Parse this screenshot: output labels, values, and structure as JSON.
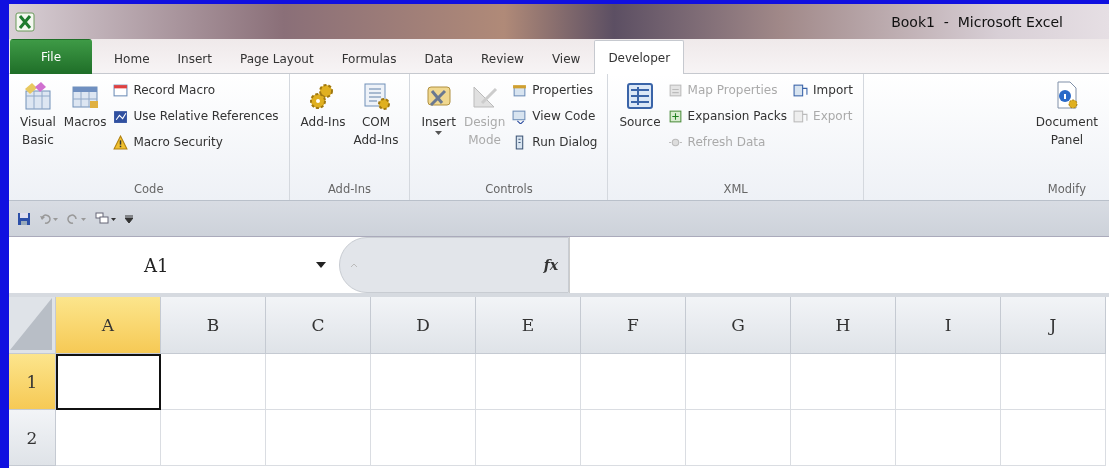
{
  "window": {
    "title": "Book1  -  Microsoft Excel"
  },
  "tabs": [
    {
      "label": "File",
      "kind": "file",
      "selected": false
    },
    {
      "label": "Home",
      "kind": "tab",
      "selected": false
    },
    {
      "label": "Insert",
      "kind": "tab",
      "selected": false
    },
    {
      "label": "Page Layout",
      "kind": "tab",
      "selected": false
    },
    {
      "label": "Formulas",
      "kind": "tab",
      "selected": false
    },
    {
      "label": "Data",
      "kind": "tab",
      "selected": false
    },
    {
      "label": "Review",
      "kind": "tab",
      "selected": false
    },
    {
      "label": "View",
      "kind": "tab",
      "selected": false
    },
    {
      "label": "Developer",
      "kind": "tab",
      "selected": true
    }
  ],
  "ribbon": {
    "groups": [
      {
        "label": "Code",
        "items": [
          {
            "kind": "large",
            "label": "Visual\nBasic",
            "disabled": false
          },
          {
            "kind": "large",
            "label": "Macros",
            "disabled": false
          },
          {
            "kind": "stack",
            "items": [
              {
                "label": "Record Macro",
                "disabled": false
              },
              {
                "label": "Use Relative References",
                "disabled": false
              },
              {
                "label": "Macro Security",
                "disabled": false
              }
            ]
          }
        ]
      },
      {
        "label": "Add-Ins",
        "items": [
          {
            "kind": "large",
            "label": "Add-Ins",
            "disabled": false
          },
          {
            "kind": "large",
            "label": "COM\nAdd-Ins",
            "disabled": false
          }
        ]
      },
      {
        "label": "Controls",
        "items": [
          {
            "kind": "large",
            "label": "Insert",
            "disabled": false,
            "dropdown": true
          },
          {
            "kind": "large",
            "label": "Design\nMode",
            "disabled": true
          },
          {
            "kind": "stack",
            "items": [
              {
                "label": "Properties",
                "disabled": false
              },
              {
                "label": "View Code",
                "disabled": false
              },
              {
                "label": "Run Dialog",
                "disabled": false
              }
            ]
          }
        ]
      },
      {
        "label": "XML",
        "items": [
          {
            "kind": "large",
            "label": "Source",
            "disabled": false
          },
          {
            "kind": "stack",
            "items": [
              {
                "label": "Map Properties",
                "disabled": true
              },
              {
                "label": "Expansion Packs",
                "disabled": false
              },
              {
                "label": "Refresh Data",
                "disabled": true
              }
            ]
          },
          {
            "kind": "stack",
            "items": [
              {
                "label": "Import",
                "disabled": false
              },
              {
                "label": "Export",
                "disabled": true
              }
            ]
          }
        ]
      },
      {
        "label": "Modify",
        "items": [
          {
            "kind": "large",
            "label": "Document\nPanel",
            "disabled": false
          }
        ]
      }
    ]
  },
  "formula_bar": {
    "name_box": "A1",
    "fx": "fx"
  },
  "sheet": {
    "columns": [
      {
        "label": "A",
        "selected": true
      },
      {
        "label": "B",
        "selected": false
      },
      {
        "label": "C",
        "selected": false
      },
      {
        "label": "D",
        "selected": false
      },
      {
        "label": "E",
        "selected": false
      },
      {
        "label": "F",
        "selected": false
      },
      {
        "label": "G",
        "selected": false
      },
      {
        "label": "H",
        "selected": false
      },
      {
        "label": "I",
        "selected": false
      },
      {
        "label": "J",
        "selected": false
      }
    ],
    "rows": [
      {
        "label": "1",
        "selected": true
      },
      {
        "label": "2",
        "selected": false
      }
    ]
  }
}
